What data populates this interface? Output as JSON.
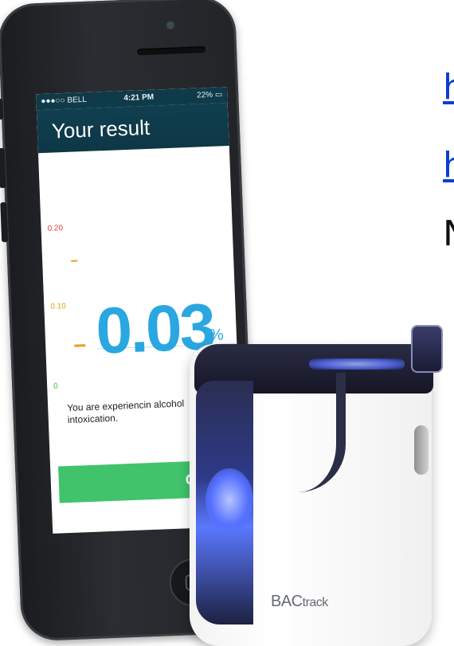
{
  "right_text": {
    "link_line_1": "h",
    "link_line_2": "h",
    "plain_line": "N"
  },
  "phone": {
    "status_bar": {
      "carrier": "●●●○○ BELL",
      "time": "4:21 PM",
      "battery": "22%"
    },
    "header_title": "Your result",
    "gauge": {
      "tick_labels": [
        "0.20",
        "0.10",
        "0"
      ],
      "colors": {
        "high": "#e23b3b",
        "mid": "#e8a217",
        "low": "#3cba4a"
      }
    },
    "result": {
      "value": "0.03",
      "unit": "%",
      "value_color": "#2aa7e0"
    },
    "message": "You are experiencin alcohol intoxication.",
    "ok_label": "OK",
    "ok_color": "#41c36b"
  },
  "device": {
    "brand_prefix": "BAC",
    "brand_suffix": "track"
  }
}
